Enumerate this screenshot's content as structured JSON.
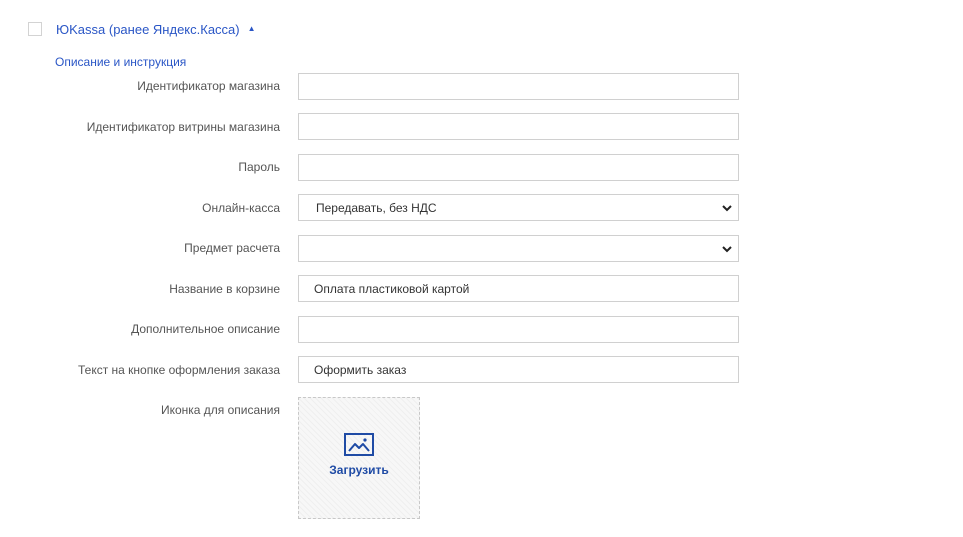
{
  "module": {
    "title": "ЮKassa (ранее Яндекс.Касса)",
    "description_link": "Описание и инструкция"
  },
  "fields": [
    {
      "label": "Идентификатор магазина",
      "value": ""
    },
    {
      "label": "Идентификатор витрины магазина",
      "value": ""
    },
    {
      "label": "Пароль",
      "value": ""
    },
    {
      "label": "Онлайн-касса",
      "value": "Передавать, без НДС"
    },
    {
      "label": "Предмет расчета",
      "value": ""
    },
    {
      "label": "Название в корзине",
      "value": "Оплата пластиковой картой"
    },
    {
      "label": "Дополнительное описание",
      "value": ""
    },
    {
      "label": "Текст на кнопке оформления заказа",
      "value": "Оформить заказ"
    },
    {
      "label": "Иконка для описания"
    }
  ],
  "upload": {
    "label": "Загрузить"
  },
  "colors": {
    "accent": "#2a56c6",
    "label": "#555555",
    "border": "#d0d0d0"
  },
  "icons": [
    "checkbox",
    "caret-up-icon",
    "chevron-down-icon",
    "image-icon"
  ]
}
